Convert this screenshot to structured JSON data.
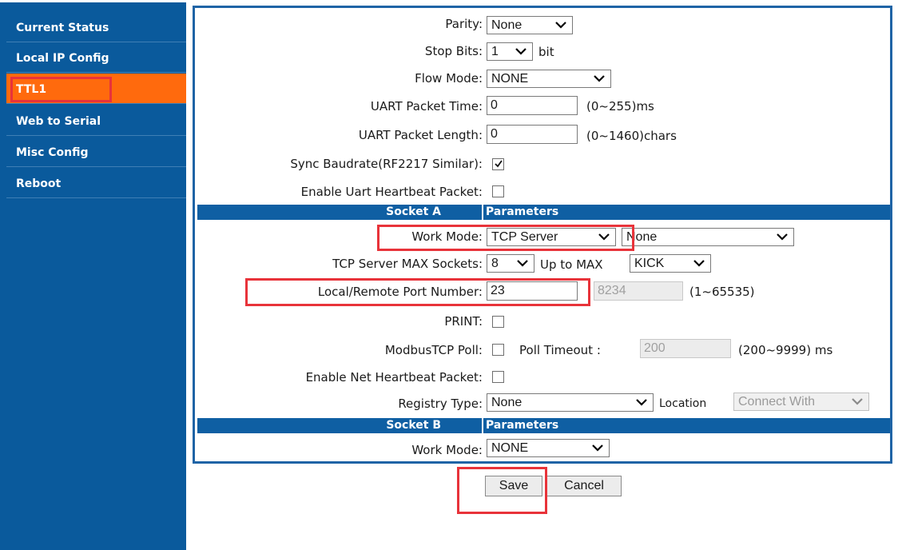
{
  "sidebar": {
    "items": [
      {
        "label": "Current Status"
      },
      {
        "label": "Local IP Config"
      },
      {
        "label": "TTL1"
      },
      {
        "label": "Web to Serial"
      },
      {
        "label": "Misc Config"
      },
      {
        "label": "Reboot"
      }
    ],
    "active_index": 2
  },
  "serial": {
    "parity": {
      "label": "Parity:",
      "value": "None"
    },
    "stop_bits": {
      "label": "Stop Bits:",
      "value": "1",
      "unit": "bit"
    },
    "flow_mode": {
      "label": "Flow Mode:",
      "value": "NONE"
    },
    "uart_packet_time": {
      "label": "UART Packet Time:",
      "value": "0",
      "hint": "(0~255)ms"
    },
    "uart_packet_length": {
      "label": "UART Packet Length:",
      "value": "0",
      "hint": "(0~1460)chars"
    },
    "sync_baudrate": {
      "label": "Sync Baudrate(RF2217 Similar):",
      "checked": true
    },
    "uart_heartbeat": {
      "label": "Enable Uart Heartbeat Packet:",
      "checked": false
    }
  },
  "socket_a": {
    "header_left": "Socket A",
    "header_right": "Parameters",
    "work_mode": {
      "label": "Work Mode:",
      "value": "TCP Server",
      "secondary": "None"
    },
    "max_sockets": {
      "label": "TCP Server MAX Sockets:",
      "value": "8",
      "upto_label": "Up to MAX",
      "upto_value": "KICK"
    },
    "port": {
      "label": "Local/Remote Port Number:",
      "value": "23",
      "remote_value": "8234",
      "hint": "(1~65535)"
    },
    "print": {
      "label": "PRINT:",
      "checked": false
    },
    "modbus": {
      "label": "ModbusTCP Poll:",
      "checked": false,
      "timeout_label": "Poll Timeout :",
      "timeout_value": "200",
      "hint": "(200~9999) ms"
    },
    "net_heartbeat": {
      "label": "Enable Net Heartbeat Packet:",
      "checked": false
    },
    "registry": {
      "label": "Registry Type:",
      "value": "None",
      "location_label": "Location",
      "location_value": "Connect With"
    }
  },
  "socket_b": {
    "header_left": "Socket B",
    "header_right": "Parameters",
    "work_mode": {
      "label": "Work Mode:",
      "value": "NONE"
    }
  },
  "buttons": {
    "save": "Save",
    "cancel": "Cancel"
  },
  "colors": {
    "sidebar": "#0a5a9c",
    "active": "#ff6a0d",
    "section": "#0f5fa3",
    "highlight": "#e8333a"
  }
}
